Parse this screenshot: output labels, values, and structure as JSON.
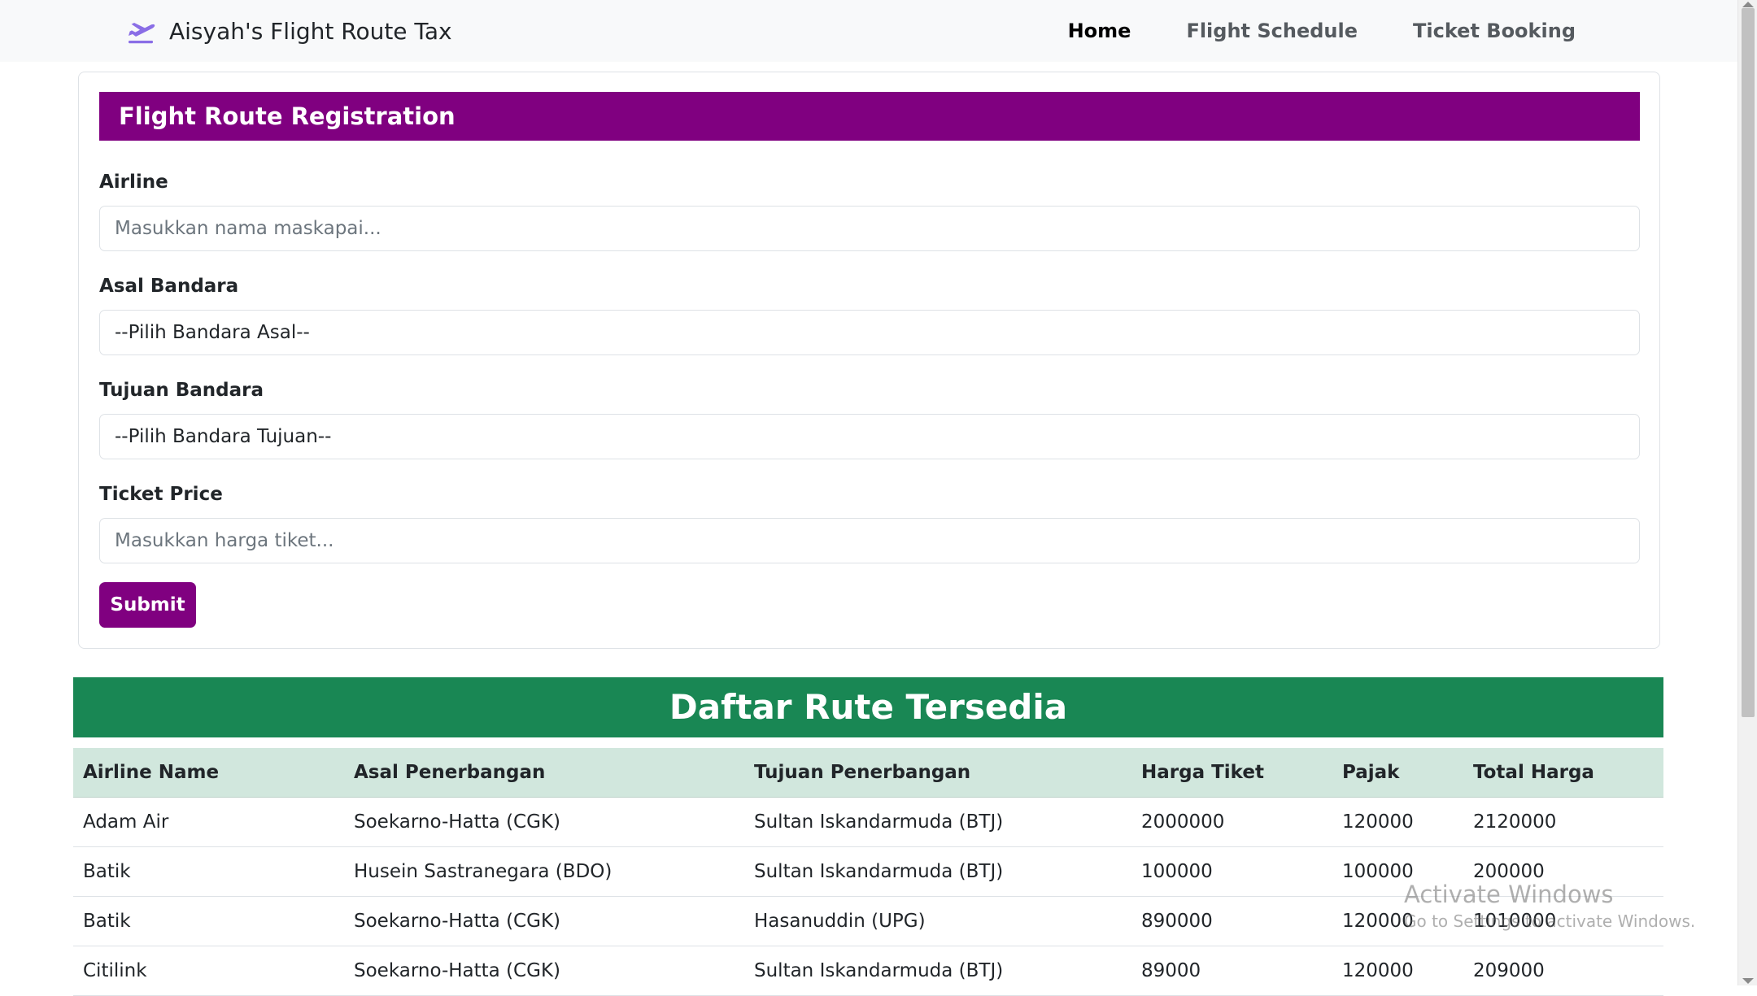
{
  "navbar": {
    "brand": "Aisyah's Flight Route Tax",
    "brand_icon": "airplane-takeoff-icon",
    "links": [
      {
        "label": "Home",
        "active": true
      },
      {
        "label": "Flight Schedule",
        "active": false
      },
      {
        "label": "Ticket Booking",
        "active": false
      }
    ]
  },
  "form": {
    "header": "Flight Route Registration",
    "airline": {
      "label": "Airline",
      "placeholder": "Masukkan nama maskapai..."
    },
    "origin": {
      "label": "Asal Bandara",
      "selected": "--Pilih Bandara Asal--"
    },
    "destination": {
      "label": "Tujuan Bandara",
      "selected": "--Pilih Bandara Tujuan--"
    },
    "price": {
      "label": "Ticket Price",
      "placeholder": "Masukkan harga tiket..."
    },
    "submit_label": "Submit"
  },
  "routes": {
    "title": "Daftar Rute Tersedia",
    "columns": [
      "Airline Name",
      "Asal Penerbangan",
      "Tujuan Penerbangan",
      "Harga Tiket",
      "Pajak",
      "Total Harga"
    ],
    "rows": [
      [
        "Adam Air",
        "Soekarno-Hatta (CGK)",
        "Sultan Iskandarmuda (BTJ)",
        "2000000",
        "120000",
        "2120000"
      ],
      [
        "Batik",
        "Husein Sastranegara (BDO)",
        "Sultan Iskandarmuda (BTJ)",
        "100000",
        "100000",
        "200000"
      ],
      [
        "Batik",
        "Soekarno-Hatta (CGK)",
        "Hasanuddin (UPG)",
        "890000",
        "120000",
        "1010000"
      ],
      [
        "Citilink",
        "Soekarno-Hatta (CGK)",
        "Sultan Iskandarmuda (BTJ)",
        "89000",
        "120000",
        "209000"
      ]
    ]
  },
  "watermark": {
    "title": "Activate Windows",
    "subtitle": "Go to Settings to activate Windows."
  },
  "colors": {
    "primary_purple": "#800080",
    "header_green": "#198754",
    "table_header_bg": "#d1e7dd",
    "navbar_bg": "#f8f9fa",
    "brand_icon": "#8a6ee6"
  }
}
